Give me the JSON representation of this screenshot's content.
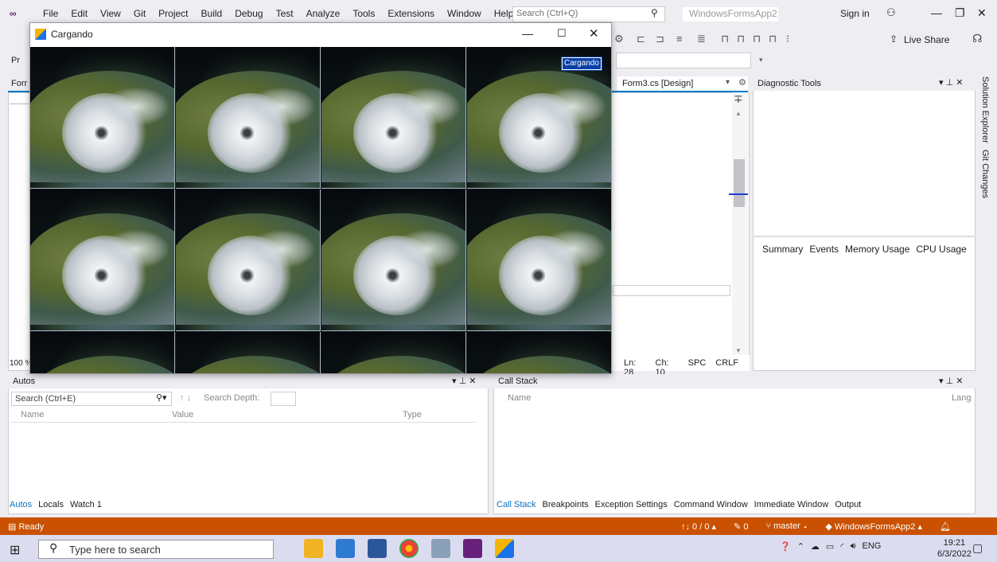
{
  "menu": {
    "items": [
      "File",
      "Edit",
      "View",
      "Git",
      "Project",
      "Build",
      "Debug",
      "Test",
      "Analyze",
      "Tools",
      "Extensions",
      "Window",
      "Help"
    ],
    "search_placeholder": "Search (Ctrl+Q)",
    "solution_name": "WindowsFormsApp2",
    "sign_in": "Sign in"
  },
  "toolbar": {
    "live_share": "Live Share",
    "sub_label": "Pr"
  },
  "editor": {
    "left_tab_fragment": "Forr",
    "designer_tab": "Form3.cs [Design]",
    "zoom": "100 %",
    "status": {
      "line": "Ln: 28",
      "char": "Ch: 10",
      "mode": "SPC",
      "eol": "CRLF"
    }
  },
  "diagnostic": {
    "title": "Diagnostic Tools",
    "tabs": [
      "Summary",
      "Events",
      "Memory Usage",
      "CPU Usage"
    ]
  },
  "side_tabs": [
    "Solution Explorer",
    "Git Changes"
  ],
  "autos": {
    "title": "Autos",
    "search_placeholder": "Search (Ctrl+E)",
    "search_depth": "Search Depth:",
    "columns": [
      "Name",
      "Value",
      "Type"
    ],
    "tabs": [
      "Autos",
      "Locals",
      "Watch 1"
    ]
  },
  "callstack": {
    "title": "Call Stack",
    "columns": [
      "Name",
      "Lang"
    ],
    "tabs": [
      "Call Stack",
      "Breakpoints",
      "Exception Settings",
      "Command Window",
      "Immediate Window",
      "Output"
    ]
  },
  "statusbar": {
    "ready": "Ready",
    "changes": "↑↓ 0 / 0 ▴",
    "edits": "0",
    "branch": "master ▴",
    "repo": "WindowsFormsApp2 ▴"
  },
  "taskbar": {
    "search_placeholder": "Type here to search",
    "language": "ENG",
    "time": "19:21",
    "date": "6/3/2022"
  },
  "form_window": {
    "title": "Cargando",
    "label": "Cargando"
  },
  "colors": {
    "accent": "#007acc",
    "statusbar": "#ca5100",
    "selection_label": "#0a3fa6"
  }
}
